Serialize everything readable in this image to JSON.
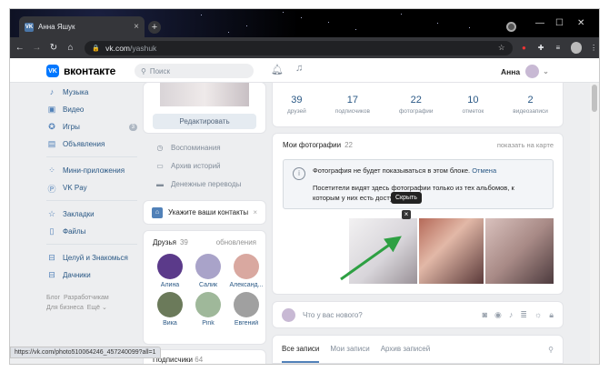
{
  "browser": {
    "tab_title": "Анна Яшук",
    "tab_favicon": "VK",
    "new_tab": "+",
    "url_host": "vk.com",
    "url_path": "/yashuk",
    "status_url": "https://vk.com/photo510064246_457240099?all=1"
  },
  "vk": {
    "logo_text": "вконтакте",
    "logo_mark": "VK",
    "search_placeholder": "Поиск",
    "user_name": "Анна"
  },
  "left_menu": {
    "items": [
      {
        "label": "Музыка",
        "icon": "music-icon"
      },
      {
        "label": "Видео",
        "icon": "video-icon"
      },
      {
        "label": "Игры",
        "icon": "games-icon",
        "badge": "3"
      },
      {
        "label": "Объявления",
        "icon": "ads-icon"
      },
      {
        "label": "Мини-приложения",
        "icon": "apps-icon"
      },
      {
        "label": "VK Pay",
        "icon": "vkpay-icon"
      },
      {
        "label": "Закладки",
        "icon": "bookmark-icon"
      },
      {
        "label": "Файлы",
        "icon": "files-icon"
      },
      {
        "label": "Целуй и Знакомься",
        "icon": "group-icon"
      },
      {
        "label": "Дачники",
        "icon": "group-icon"
      }
    ],
    "footer": {
      "blog": "Блог",
      "developers": "Разработчикам",
      "business": "Для бизнеса",
      "more": "Ещё"
    }
  },
  "middle": {
    "edit_button": "Редактировать",
    "links": [
      {
        "label": "Воспоминания"
      },
      {
        "label": "Архив историй"
      },
      {
        "label": "Денежные переводы"
      }
    ],
    "contacts_prompt": "Укажите ваши контакты",
    "friends": {
      "title": "Друзья",
      "count": "39",
      "updates": "обновления",
      "items": [
        {
          "name": "Алина",
          "color": "#5b3a8a"
        },
        {
          "name": "Салик",
          "color": "#a9a3c9"
        },
        {
          "name": "Александ...",
          "color": "#d9a8a0"
        },
        {
          "name": "Вика",
          "color": "#6b7a5a"
        },
        {
          "name": "Pink",
          "color": "#9fb89a"
        },
        {
          "name": "Евгений",
          "color": "#a0a0a0"
        }
      ]
    },
    "subscribers": {
      "title": "Подписчики",
      "count": "64"
    }
  },
  "stats": [
    {
      "value": "39",
      "label": "друзей"
    },
    {
      "value": "17",
      "label": "подписчиков"
    },
    {
      "value": "22",
      "label": "фотографии"
    },
    {
      "value": "10",
      "label": "отметок"
    },
    {
      "value": "2",
      "label": "видеозаписи"
    }
  ],
  "photos": {
    "title": "Мои фотографии",
    "count": "22",
    "show_on_map": "показать на карте",
    "notice_line1": "Фотография не будет показываться в этом блоке.",
    "notice_undo": "Отмена",
    "notice_line2": "Посетители видят здесь фотографии только из тех альбомов, к которым у них есть доступ.",
    "hide_tooltip": "Скрыть",
    "hide_button": "×"
  },
  "new_post": {
    "placeholder": "Что у вас нового?"
  },
  "wall_tabs": [
    {
      "label": "Все записи"
    },
    {
      "label": "Мои записи"
    },
    {
      "label": "Архив записей"
    }
  ],
  "colors": {
    "vk_blue": "#0077ff",
    "link": "#2a5885",
    "arrow": "#2ea043"
  }
}
